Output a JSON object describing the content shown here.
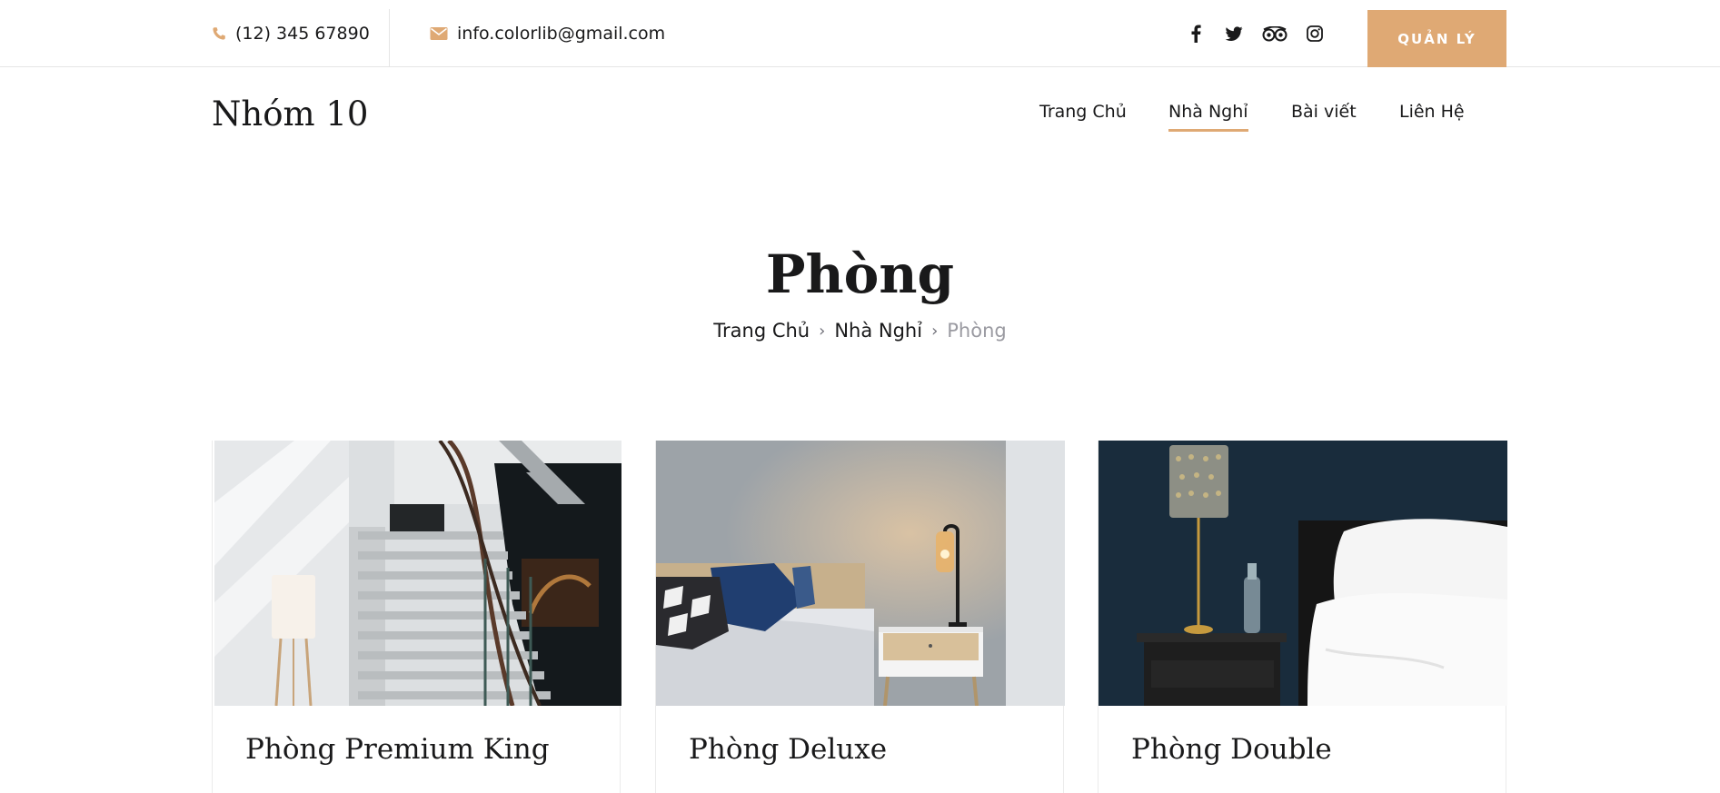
{
  "topbar": {
    "phone": "(12) 345 67890",
    "email": "info.colorlib@gmail.com",
    "social_icons": [
      "facebook-icon",
      "twitter-icon",
      "tripadvisor-icon",
      "instagram-icon"
    ],
    "admin_button": "QUẢN LÝ"
  },
  "header": {
    "logo": "Nhóm 10",
    "nav": [
      {
        "label": "Trang Chủ"
      },
      {
        "label": "Nhà Nghỉ",
        "active": true
      },
      {
        "label": "Bài viết"
      },
      {
        "label": "Liên Hệ"
      }
    ]
  },
  "page": {
    "title": "Phòng",
    "breadcrumb": {
      "home": "Trang Chủ",
      "parent": "Nhà Nghỉ",
      "current": "Phòng"
    }
  },
  "rooms": [
    {
      "name": "Phòng Premium King"
    },
    {
      "name": "Phòng Deluxe"
    },
    {
      "name": "Phòng Double"
    }
  ],
  "colors": {
    "accent": "#dfa974",
    "text": "#19191a",
    "muted": "#9a9aa1"
  }
}
